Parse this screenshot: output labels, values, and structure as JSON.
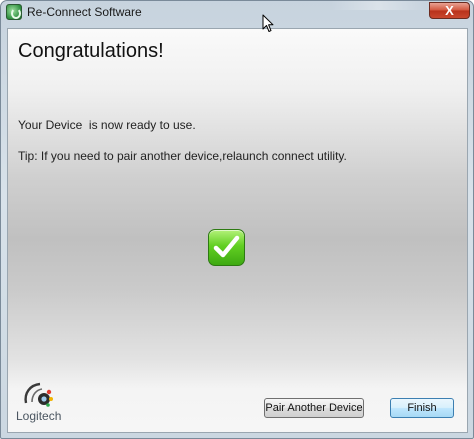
{
  "window": {
    "title": "Re-Connect Software",
    "close_label": "X"
  },
  "dialog": {
    "headline": "Congratulations!",
    "ready_message": "Your Device  is now ready to use.",
    "tip": "Tip: If you need to pair another device,relaunch connect utility."
  },
  "footer": {
    "logo_text": "Logitech",
    "pair_button": "Pair Another Device",
    "finish_button": "Finish"
  },
  "icons": {
    "app": "reconnect-app-icon",
    "success": "checkmark-icon",
    "logo": "logitech-logo-icon"
  },
  "colors": {
    "success_green": "#4cbf18",
    "close_red": "#c9472e",
    "finish_blue": "#3c7fb1"
  }
}
